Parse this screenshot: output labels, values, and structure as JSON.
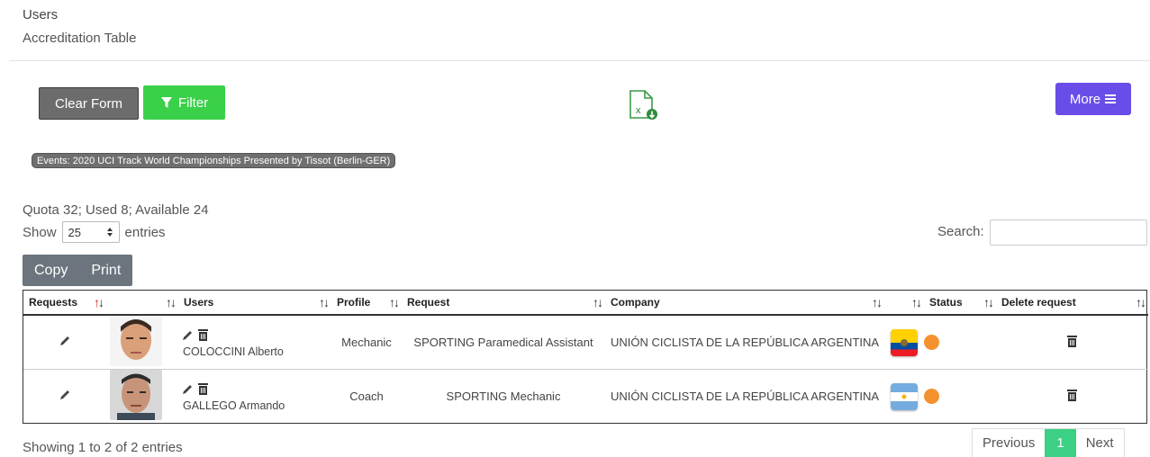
{
  "breadcrumb": {
    "title": "Users",
    "subtitle": "Accreditation Table"
  },
  "toolbar": {
    "clear_label": "Clear Form",
    "filter_label": "Filter",
    "more_label": "More",
    "export_icon": "excel-export-icon"
  },
  "event_badge": "Events: 2020 UCI Track World Championships Presented by Tissot (Berlin-GER)",
  "quota_text": "Quota 32; Used 8; Available 24",
  "length": {
    "show": "Show",
    "value": "25",
    "entries": "entries"
  },
  "search": {
    "label": "Search:",
    "value": ""
  },
  "export_buttons": {
    "copy": "Copy",
    "print": "Print"
  },
  "table": {
    "headers": [
      "Requests",
      "",
      "Users",
      "Profile",
      "Request",
      "Company",
      "",
      "Status",
      "Delete request"
    ],
    "rows": [
      {
        "user": "COLOCCINI Alberto",
        "profile": "Mechanic",
        "request": "SPORTING Paramedical Assistant",
        "company": "UNIÓN CICLISTA DE LA REPÚBLICA ARGENTINA",
        "flag": "ecuador",
        "status_color": "#f5922f"
      },
      {
        "user": "GALLEGO Armando",
        "profile": "Coach",
        "request": "SPORTING Mechanic",
        "company": "UNIÓN CICLISTA DE LA REPÚBLICA ARGENTINA",
        "flag": "argentina",
        "status_color": "#f5922f"
      }
    ]
  },
  "info_text": "Showing 1 to 2 of 2 entries",
  "pagination": {
    "previous": "Previous",
    "current": "1",
    "next": "Next"
  },
  "colors": {
    "filter": "#3bd04a",
    "more": "#6a4de8",
    "page_active": "#3bd083",
    "status": "#f5922f"
  }
}
